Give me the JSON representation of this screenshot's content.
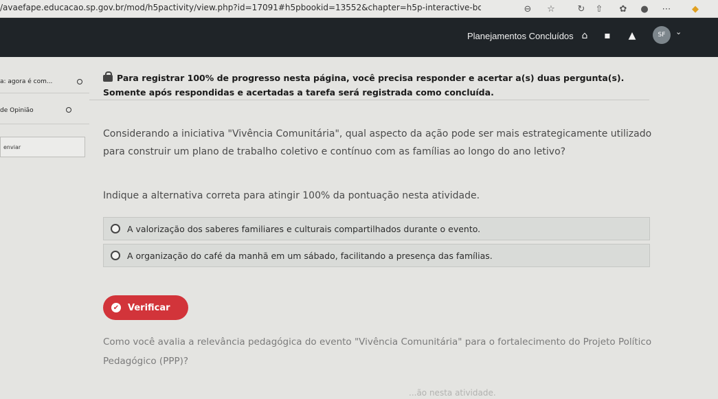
{
  "browser": {
    "url": "/avaefape.educacao.sp.gov.br/mod/h5pactivity/view.php?id=17091#h5pbookid=13552&chapter=h5p-interactive-book-chapter-...",
    "icons": [
      "minus-circle-icon",
      "star-icon",
      "refresh-icon",
      "share-icon",
      "leaf-icon",
      "profile-icon",
      "more-icon",
      "extension-icon"
    ]
  },
  "header": {
    "title": "Planejamentos Concluídos",
    "avatar_initials": "SF"
  },
  "sidebar": {
    "items": [
      {
        "label": "a: agora é com..."
      },
      {
        "label": "de Opinião"
      }
    ],
    "input_value": "enviar"
  },
  "notice": {
    "line1": "Para registrar 100% de progresso nesta página, você precisa responder e acertar a(s) duas pergunta(s).",
    "line2": "Somente após respondidas e acertadas a tarefa será registrada como concluída."
  },
  "question": {
    "text": "Considerando a iniciativa \"Vivência Comunitária\", qual aspecto da ação pode ser mais estrategicamente utilizado para construir um plano de trabalho coletivo e contínuo com as famílias ao longo do ano letivo?",
    "instruction": "Indique a alternativa correta para atingir 100% da pontuação nesta atividade.",
    "options": [
      {
        "label": "A valorização dos saberes familiares e culturais compartilhados durante o evento."
      },
      {
        "label": "A organização do café da manhã em um sábado, facilitando a presença das famílias."
      }
    ],
    "check_label": "Verificar"
  },
  "next_question": {
    "text": "Como você avalia a relevância pedagógica do evento \"Vivência Comunitária\" para o fortalecimento do Projeto Político Pedagógico (PPP)?"
  },
  "faded_text": "...ão nesta atividade.",
  "colors": {
    "header_bg": "#1f2428",
    "check_button": "#d2343a",
    "option_bg": "#d9dbd8",
    "page_bg": "#e4e4e1"
  }
}
